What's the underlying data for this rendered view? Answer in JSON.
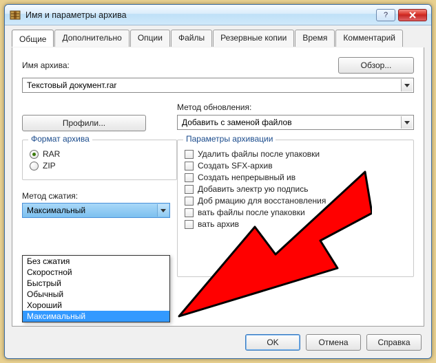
{
  "title": "Имя и параметры архива",
  "tabs": [
    "Общие",
    "Дополнительно",
    "Опции",
    "Файлы",
    "Резервные копии",
    "Время",
    "Комментарий"
  ],
  "archive_name_label": "Имя архива:",
  "browse": "Обзор...",
  "archive_name": "Текстовый документ.rar",
  "update_label": "Метод обновления:",
  "profiles": "Профили...",
  "update_method": "Добавить с заменой файлов",
  "format_group": "Формат архива",
  "format": {
    "rar": "RAR",
    "zip": "ZIP"
  },
  "compression_label": "Метод сжатия:",
  "compression_value": "Максимальный",
  "compression_options": [
    "Без сжатия",
    "Скоростной",
    "Быстрый",
    "Обычный",
    "Хороший",
    "Максимальный"
  ],
  "params_group": "Параметры архивации",
  "params": [
    "Удалить файлы после упаковки",
    "Создать SFX-архив",
    "Создать непрерывный    ив",
    "Добавить электр      ую подпись",
    "Доб               рмацию для восстановления",
    "            вать файлы после упаковки",
    "               вать архив"
  ],
  "buttons": {
    "ok": "OK",
    "cancel": "Отмена",
    "help": "Справка"
  }
}
